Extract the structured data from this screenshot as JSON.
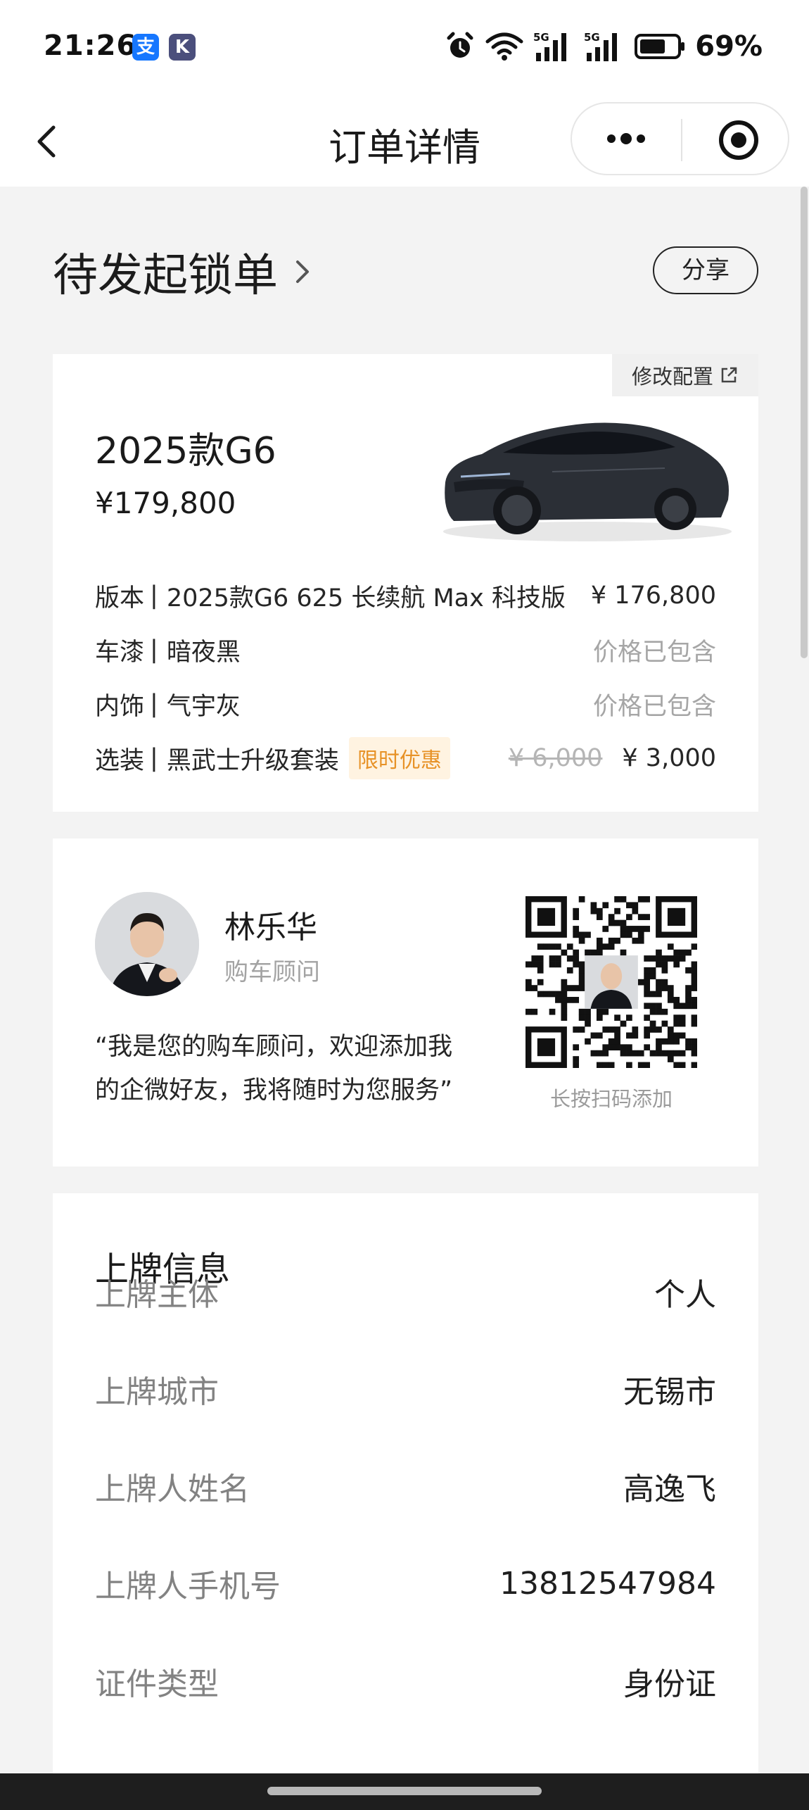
{
  "status_bar": {
    "time": "21:26",
    "apps": [
      {
        "icon": "alipay-icon",
        "glyph": "支",
        "color": "#1677ff"
      },
      {
        "icon": "k-app-icon",
        "glyph": "K",
        "color": "#4b4f7c"
      }
    ],
    "signal_1": "5G",
    "signal_2": "5G",
    "battery_percent": "69%",
    "battery_level": 0.69
  },
  "nav": {
    "title": "订单详情",
    "back_icon": "chevron-left-icon",
    "more_icon": "more-dots-icon",
    "close_icon": "target-circle-icon"
  },
  "order": {
    "status": "待发起锁单",
    "share_label": "分享"
  },
  "car": {
    "modify_label": "修改配置",
    "model": "2025款G6",
    "price": "¥179,800",
    "configs": [
      {
        "key": "版本",
        "value": "2025款G6 625 长续航 Max 科技版",
        "price": "¥ 176,800"
      },
      {
        "key": "车漆",
        "value": "暗夜黑",
        "price": "价格已包含"
      },
      {
        "key": "内饰",
        "value": "气宇灰",
        "price": "价格已包含"
      },
      {
        "key": "选装",
        "value": "黑武士升级套装",
        "badge": "限时优惠",
        "original_price": "¥ 6,000",
        "price": "¥ 3,000"
      }
    ]
  },
  "advisor": {
    "name": "林乐华",
    "role": "购车顾问",
    "quote_line1": "“我是您的购车顾问，欢迎添加我",
    "quote_line2": "的企微好友，我将随时为您服务”",
    "qr_hint": "长按扫码添加"
  },
  "plate": {
    "title": "上牌信息",
    "rows": [
      {
        "key": "上牌主体",
        "value": "个人"
      },
      {
        "key": "上牌城市",
        "value": "无锡市"
      },
      {
        "key": "上牌人姓名",
        "value": "高逸飞"
      },
      {
        "key": "上牌人手机号",
        "value": "13812547984"
      },
      {
        "key": "证件类型",
        "value": "身份证"
      }
    ]
  }
}
